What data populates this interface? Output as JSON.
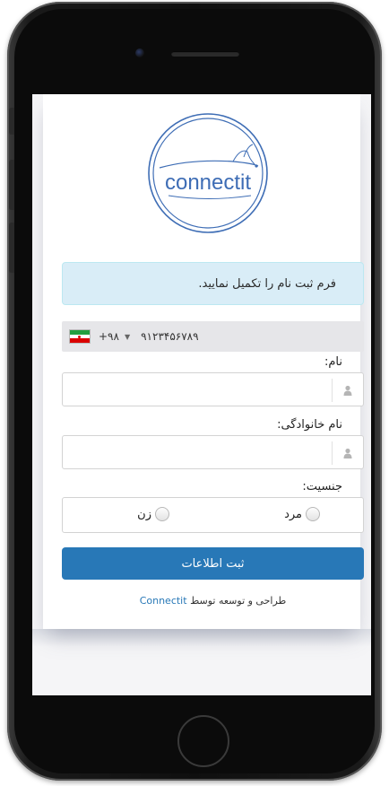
{
  "app": {
    "logo_text": "connectit"
  },
  "alert": {
    "text": "فرم ثبت نام را تکمیل نمایید."
  },
  "phone": {
    "country": "IR",
    "dial_code": "+۹۸",
    "caret": "▼",
    "number": "۹۱۲۳۴۵۶۷۸۹"
  },
  "first_name": {
    "label": "نام:",
    "value": "",
    "icon": "user-icon"
  },
  "last_name": {
    "label": "نام خانوادگی:",
    "value": "",
    "icon": "user-icon"
  },
  "gender": {
    "label": "جنسیت:",
    "options": [
      {
        "label": "مرد",
        "selected": false
      },
      {
        "label": "زن",
        "selected": false
      }
    ]
  },
  "submit": {
    "label": "ثبت اطلاعات"
  },
  "footer": {
    "prefix": "طراحی و توسعه توسط",
    "brand": "Connectit"
  },
  "colors": {
    "accent": "#2878b7",
    "alert_bg": "#d9edf7",
    "logo_blue": "#3e6db5"
  }
}
